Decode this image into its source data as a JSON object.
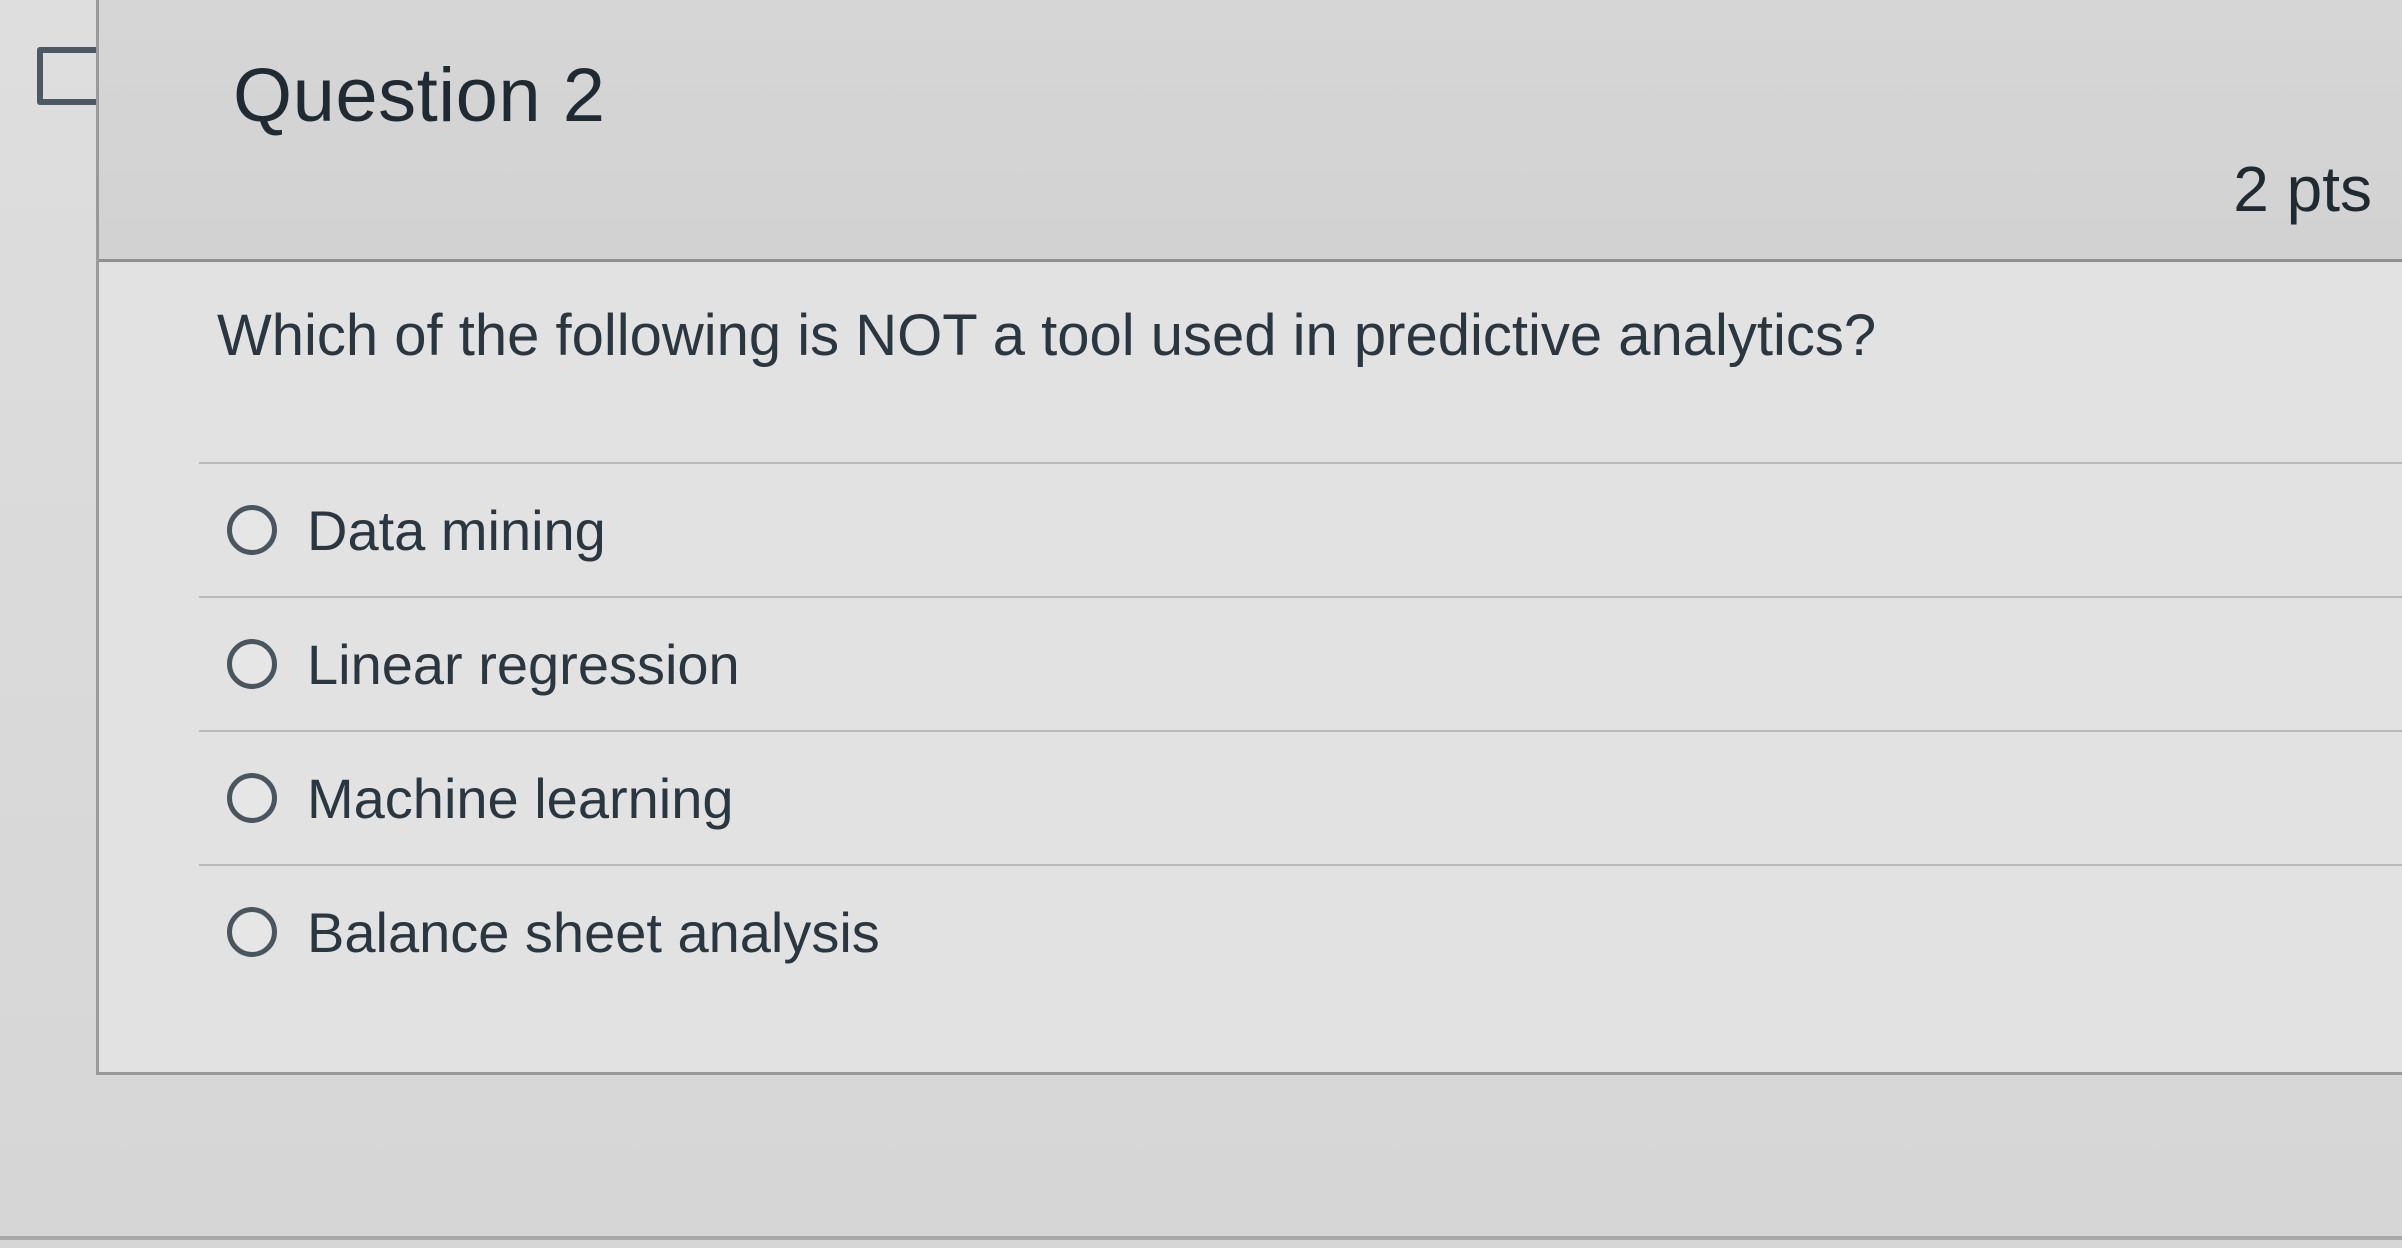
{
  "question": {
    "title": "Question 2",
    "points": "2 pts",
    "text": "Which of the following is NOT a tool used in predictive analytics?",
    "answers": [
      {
        "label": "Data mining"
      },
      {
        "label": "Linear regression"
      },
      {
        "label": "Machine learning"
      },
      {
        "label": "Balance sheet analysis"
      }
    ]
  },
  "icons": {
    "flag": "flag-icon",
    "radio": "radio-button-icon"
  },
  "colors": {
    "text": "#2d3b45",
    "border": "#9a9a9a",
    "header_bg": "#d4d4d4"
  }
}
